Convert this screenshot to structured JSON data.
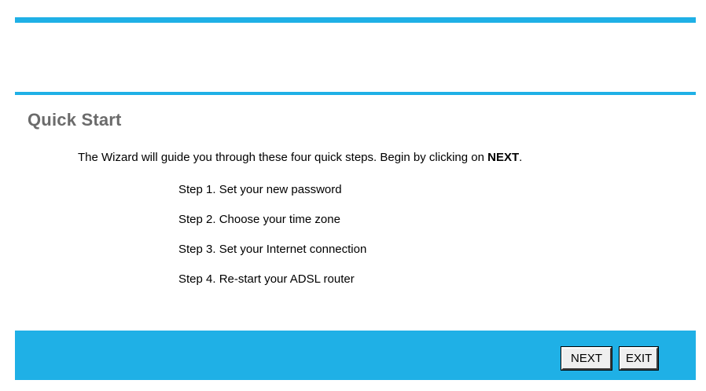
{
  "page": {
    "title": "Quick Start"
  },
  "intro": {
    "text_before": "The Wizard will guide you through these four quick steps. Begin by clicking on ",
    "emphasis": "NEXT",
    "text_after": "."
  },
  "steps": [
    {
      "label": "Step 1. Set your new password"
    },
    {
      "label": "Step 2. Choose your time zone"
    },
    {
      "label": "Step 3. Set your Internet connection"
    },
    {
      "label": "Step 4. Re-start your ADSL router"
    }
  ],
  "footer": {
    "next_label": "NEXT",
    "exit_label": "EXIT"
  },
  "colors": {
    "accent": "#1fb0e6",
    "title": "#6b6b6b"
  }
}
